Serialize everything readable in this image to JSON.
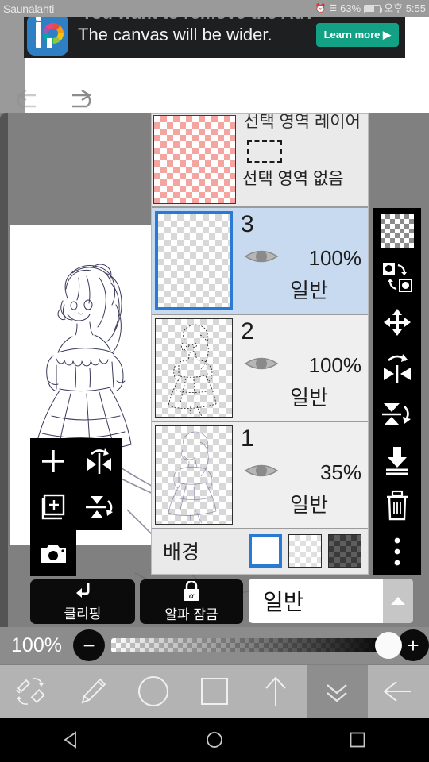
{
  "statusbar": {
    "carrier": "Saunalahti",
    "battery_pct": "63%",
    "time": "오후 5:55",
    "alarm_icon": "alarm-icon",
    "signal_icon": "signal-icon",
    "battery_icon": "battery-icon"
  },
  "ad": {
    "headline": "You want to remove the Ad?",
    "subline": "The canvas will be wider.",
    "cta": "Learn more ▶",
    "cta_color": "#13a185",
    "logo_name": "ibispaint-logo"
  },
  "header": {
    "undo_label": "undo",
    "redo_label": "redo"
  },
  "left_tools": [
    {
      "name": "add-layer-button",
      "icon": "plus-icon"
    },
    {
      "name": "flip-horizontal-button",
      "icon": "flip-horizontal-icon"
    },
    {
      "name": "duplicate-layer-button",
      "icon": "copy-plus-icon"
    },
    {
      "name": "flip-vertical-button",
      "icon": "flip-vertical-icon"
    },
    {
      "name": "camera-button",
      "icon": "camera-icon"
    }
  ],
  "layers_panel": {
    "selection_row": {
      "title": "선택 영역 레이어",
      "status": "선택 영역 없음",
      "thumb_color": "#f4a5a0",
      "dash_icon": "dashed-rectangle-icon"
    },
    "layers": [
      {
        "name": "3",
        "opacity": "100%",
        "blend": "일반",
        "selected": true,
        "visible": true,
        "eye_icon": "eye-icon"
      },
      {
        "name": "2",
        "opacity": "100%",
        "blend": "일반",
        "selected": false,
        "visible": true,
        "eye_icon": "eye-icon"
      },
      {
        "name": "1",
        "opacity": "35%",
        "blend": "일반",
        "selected": false,
        "visible": true,
        "eye_icon": "eye-icon"
      }
    ],
    "background": {
      "label": "배경",
      "swatches": [
        "white",
        "light-checker",
        "dark-checker"
      ],
      "selected_index": 0,
      "selected_color": "#2a7ad4"
    }
  },
  "right_tools": [
    {
      "name": "transparency-checker-button",
      "icon": "checkerboard-icon"
    },
    {
      "name": "swap-layers-button",
      "icon": "swap-objects-icon"
    },
    {
      "name": "move-layer-button",
      "icon": "move-arrows-icon"
    },
    {
      "name": "rotate-flip-horizontal-button",
      "icon": "rotate-flip-horizontal-icon"
    },
    {
      "name": "rotate-flip-vertical-button",
      "icon": "rotate-flip-vertical-icon"
    },
    {
      "name": "merge-down-button",
      "icon": "merge-down-icon"
    },
    {
      "name": "delete-layer-button",
      "icon": "trash-icon"
    },
    {
      "name": "more-options-button",
      "icon": "kebab-menu-icon"
    }
  ],
  "lowbar": {
    "clipping_label": "클리핑",
    "clipping_icon": "clipping-arrow-icon",
    "alpha_lock_label": "알파 잠금",
    "alpha_lock_icon": "alpha-lock-icon",
    "blend_mode_value": "일반",
    "blend_arrow_icon": "chevron-up-icon"
  },
  "opacity": {
    "value": "100%",
    "minus_label": "−",
    "plus_label": "+",
    "slider_position_pct": 100
  },
  "bottom_toolbar": [
    {
      "name": "brush-eraser-swap-button",
      "icon": "brush-eraser-swap-icon",
      "active": false
    },
    {
      "name": "brush-button",
      "icon": "brush-icon",
      "active": false
    },
    {
      "name": "circle-tool-button",
      "icon": "circle-icon",
      "active": false
    },
    {
      "name": "square-tool-button",
      "icon": "square-icon",
      "active": false
    },
    {
      "name": "layer-up-button",
      "icon": "arrow-up-icon",
      "active": false
    },
    {
      "name": "collapse-panel-button",
      "icon": "double-chevron-down-icon",
      "active": true
    },
    {
      "name": "back-button",
      "icon": "arrow-left-icon",
      "active": false
    }
  ],
  "navbar": [
    {
      "name": "android-back-button",
      "icon": "triangle-left-icon"
    },
    {
      "name": "android-home-button",
      "icon": "circle-icon"
    },
    {
      "name": "android-recents-button",
      "icon": "square-icon"
    }
  ]
}
